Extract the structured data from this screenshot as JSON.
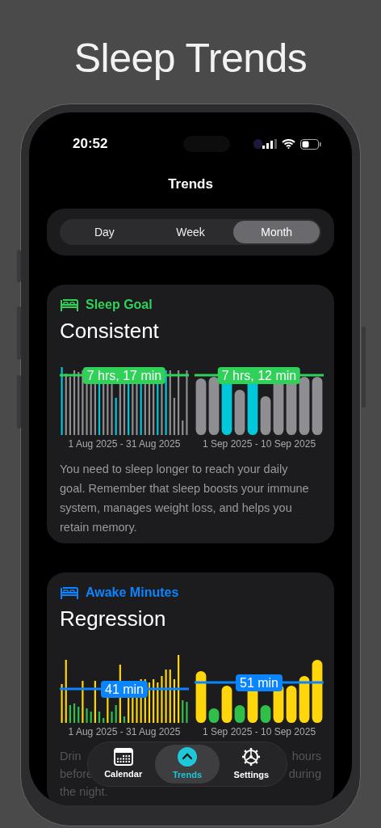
{
  "page_title": "Sleep Trends",
  "status_bar": {
    "time": "20:52"
  },
  "nav_title": "Trends",
  "segments": [
    {
      "label": "Day",
      "selected": false
    },
    {
      "label": "Week",
      "selected": false
    },
    {
      "label": "Month",
      "selected": true
    }
  ],
  "cards": [
    {
      "kind": "sleep",
      "category": "Sleep Goal",
      "color": "#30d158",
      "status": "Consistent",
      "charts": [
        {
          "average": "7 hrs, 17 min",
          "range": "1 Aug 2025 - 31 Aug 2025"
        },
        {
          "average": "7 hrs, 12 min",
          "range": "1 Sep 2025 - 10 Sep 2025"
        }
      ],
      "description_lines": [
        [
          "You need to sleep longer to reach your daily"
        ],
        [
          "goal. Remember that sleep boosts your immune"
        ],
        [
          "system, manages weight loss, and helps you"
        ],
        [
          "retain memory."
        ]
      ]
    },
    {
      "kind": "awake",
      "category": "Awake Minutes",
      "color": "#0a84ff",
      "status": "Regression",
      "charts": [
        {
          "average": "41 min",
          "range": "1 Aug 2025 - 31 Aug 2025"
        },
        {
          "average": "51 min",
          "range": "1 Sep 2025 - 10 Sep 2025"
        }
      ],
      "description_lines": [
        [
          "Drin",
          "hours"
        ],
        [
          "before",
          "during"
        ],
        [
          "the night."
        ]
      ]
    }
  ],
  "tab_bar": [
    {
      "kind": "calendar",
      "label": "Calendar",
      "selected": false
    },
    {
      "kind": "trends",
      "label": "Trends",
      "selected": true
    },
    {
      "kind": "settings",
      "label": "Settings",
      "selected": false
    }
  ]
}
